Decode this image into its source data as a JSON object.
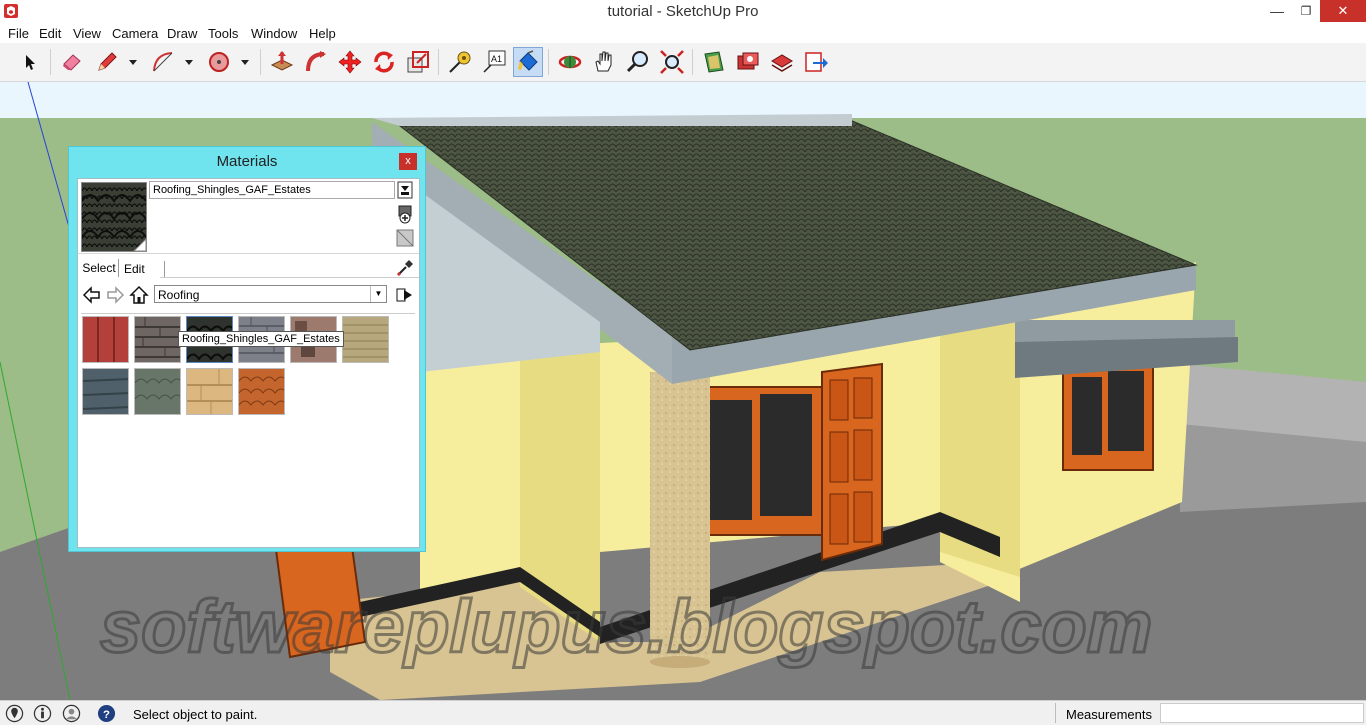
{
  "window": {
    "title": "tutorial - SketchUp Pro",
    "minimize": "—",
    "maximize": "❐",
    "close": "✕"
  },
  "menu": [
    "File",
    "Edit",
    "View",
    "Camera",
    "Draw",
    "Tools",
    "Window",
    "Help"
  ],
  "toolbar": {
    "tools": [
      "select-tool",
      "eraser-tool",
      "pencil-tool",
      "arc-tool",
      "circle-tool",
      "push-pull-tool",
      "follow-me-tool",
      "move-tool",
      "rotate-tool",
      "scale-tool",
      "tape-measure-tool",
      "text-tool",
      "paint-bucket-tool",
      "orbit-tool",
      "pan-tool",
      "zoom-tool",
      "zoom-extents-tool",
      "warehouse-tool",
      "extension-warehouse-tool",
      "send-to-layout-tool",
      "export-tool"
    ],
    "active_tool": "paint-bucket-tool",
    "text_tool_label": "A1"
  },
  "materials": {
    "title": "Materials",
    "close": "x",
    "name": "Roofing_Shingles_GAF_Estates",
    "tabs": [
      "Select",
      "Edit"
    ],
    "active_tab": "Select",
    "collection": "Roofing",
    "tooltip": "Roofing_Shingles_GAF_Estates",
    "swatch_colors": [
      "#b3403a",
      "#6d6663",
      "#2f332e",
      "#7d8088",
      "#9c7a6e",
      "#b7a77d",
      "#50606a",
      "#68766a",
      "#dcb880",
      "#c4652e"
    ]
  },
  "statusbar": {
    "message": "Select object to paint.",
    "measurements_label": "Measurements",
    "measurements_value": ""
  },
  "watermark": "softwareplupus.blogspot.com",
  "colors": {
    "panel": "#6fe3ee",
    "sky": "#e9f6fd",
    "ground": "#9cbc88",
    "wall": "#f7ee9d",
    "roof": "#4b5340",
    "door": "#d9661e"
  }
}
